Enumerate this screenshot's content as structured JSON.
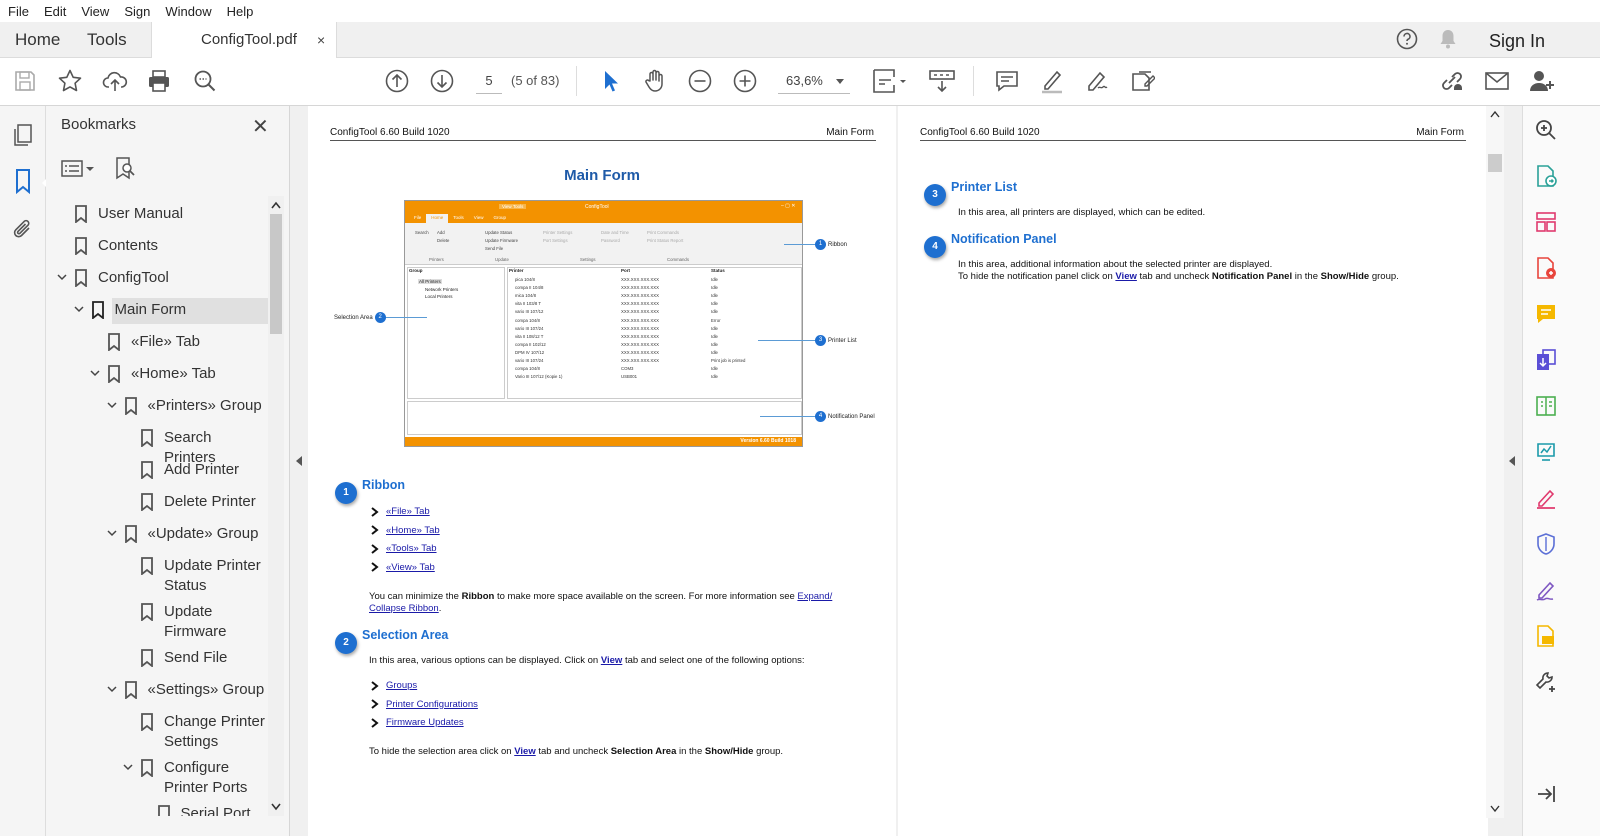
{
  "menu": [
    "File",
    "Edit",
    "View",
    "Sign",
    "Window",
    "Help"
  ],
  "tabs": {
    "home": "Home",
    "tools": "Tools",
    "doc": "ConfigTool.pdf",
    "close": "×"
  },
  "header_right": {
    "sign_in": "Sign In"
  },
  "toolbar": {
    "page": "5",
    "page_count": "(5 of 83)",
    "zoom": "63,6%"
  },
  "bookmarks": {
    "title": "Bookmarks",
    "close": "✕",
    "items": [
      {
        "label": "User Manual"
      },
      {
        "label": "Contents"
      },
      {
        "label": "ConfigTool"
      },
      {
        "label": "Main Form"
      },
      {
        "label": "«File» Tab"
      },
      {
        "label": "«Home» Tab"
      },
      {
        "label": "«Printers» Group"
      },
      {
        "label": "Search Printers"
      },
      {
        "label": "Add Printer"
      },
      {
        "label": "Delete Printer"
      },
      {
        "label": "«Update» Group"
      },
      {
        "label": "Update Printer Status"
      },
      {
        "label": "Update Firmware"
      },
      {
        "label": "Send File"
      },
      {
        "label": "«Settings» Group"
      },
      {
        "label": "Change Printer Settings"
      },
      {
        "label": "Configure Printer Ports"
      },
      {
        "label": "Serial Port"
      }
    ]
  },
  "page1": {
    "header_left": "ConfigTool 6.60 Build 1020",
    "header_right": "Main Form",
    "title": "Main Form",
    "screenshot": {
      "app_title": "ConfigTool",
      "ribbon_tabs": [
        "File",
        "Home",
        "Tools",
        "View",
        "Group"
      ],
      "view_tools": "View Tools",
      "buttons": [
        "Search",
        "Add",
        "Delete",
        "Update Status",
        "Update Firmware",
        "Send File",
        "Printer Settings",
        "Port Settings",
        "Date and Time",
        "Password",
        "Print Commands",
        "Print Status Report"
      ],
      "groups": [
        "Printers",
        "Update",
        "Settings",
        "Commands"
      ],
      "tree_header": "Group",
      "tree": [
        "All Printers",
        "Network Printers",
        "Local Printers"
      ],
      "col_headers": [
        "Printer",
        "Port",
        "Status"
      ],
      "rows": [
        [
          "pica 104/8",
          "XXX.XXX.XXX.XXX",
          "Idle"
        ],
        [
          "compa II 104/8",
          "XXX.XXX.XXX.XXX",
          "Idle"
        ],
        [
          "mica 104/8",
          "XXX.XXX.XXX.XXX",
          "Idle"
        ],
        [
          "vita II 103/8 T",
          "XXX.XXX.XXX.XXX",
          "Idle"
        ],
        [
          "vario III 107/12",
          "XXX.XXX.XXX.XXX",
          "Idle"
        ],
        [
          "compa 104/8",
          "XXX.XXX.XXX.XXX",
          "Error"
        ],
        [
          "vario III 107/24",
          "XXX.XXX.XXX.XXX",
          "Idle"
        ],
        [
          "vita II 108/12 T",
          "XXX.XXX.XXX.XXX",
          "Idle"
        ],
        [
          "compa II 102/12",
          "XXX.XXX.XXX.XXX",
          "Idle"
        ],
        [
          "DPM IV 107/12",
          "XXX.XXX.XXX.XXX",
          "Idle"
        ],
        [
          "vario III 107/24",
          "XXX.XXX.XXX.XXX",
          "Print job is printed"
        ],
        [
          "compa 104/8",
          "COM3",
          "Idle"
        ],
        [
          "Vario III 107/12 (Kopie 1)",
          "USB001",
          "Idle"
        ]
      ],
      "version": "Version 6.60 Build 1018",
      "callouts": [
        "Ribbon",
        "Selection Area",
        "Printer List",
        "Notification Panel"
      ]
    },
    "ribbon": {
      "num": "1",
      "title": "Ribbon",
      "links": [
        "«File» Tab",
        "«Home» Tab",
        "«Tools» Tab",
        "«View» Tab"
      ],
      "p1": "You can minimize the ",
      "p1b": "Ribbon",
      "p2": " to make more space available on the screen. For more information see ",
      "p2link1": "Expand/",
      "p2link2": "Collapse Ribbon",
      "p2end": "."
    },
    "selection": {
      "num": "2",
      "title": "Selection Area",
      "p1": "In this area, various options can be displayed. Click on ",
      "p1link": "View",
      "p1end": " tab and select one of the following options:",
      "links": [
        "Groups",
        "Printer Configurations",
        "Firmware Updates"
      ],
      "p2": "To hide the selection area click on ",
      "p2link": "View",
      "p2mid": " tab and uncheck ",
      "p2b": "Selection Area",
      "p2mid2": " in the ",
      "p2b2": "Show/Hide",
      "p2end": " group."
    }
  },
  "page2": {
    "header_left": "ConfigTool 6.60 Build 1020",
    "header_right": "Main Form",
    "printer_list": {
      "num": "3",
      "title": "Printer List",
      "text": "In this area, all printers are displayed, which can be edited."
    },
    "notification": {
      "num": "4",
      "title": "Notification Panel",
      "line1": "In this area, additional information about the selected printer are displayed.",
      "l2a": "To hide the notification panel click on ",
      "l2link": "View",
      "l2b": " tab and uncheck ",
      "l2bold": "Notification Panel",
      "l2c": " in the ",
      "l2bold2": "Show/Hide",
      "l2d": " group."
    }
  },
  "colors": {
    "accent": "#1e6fd0",
    "link": "#1a1aa8",
    "orange": "#f39200"
  }
}
